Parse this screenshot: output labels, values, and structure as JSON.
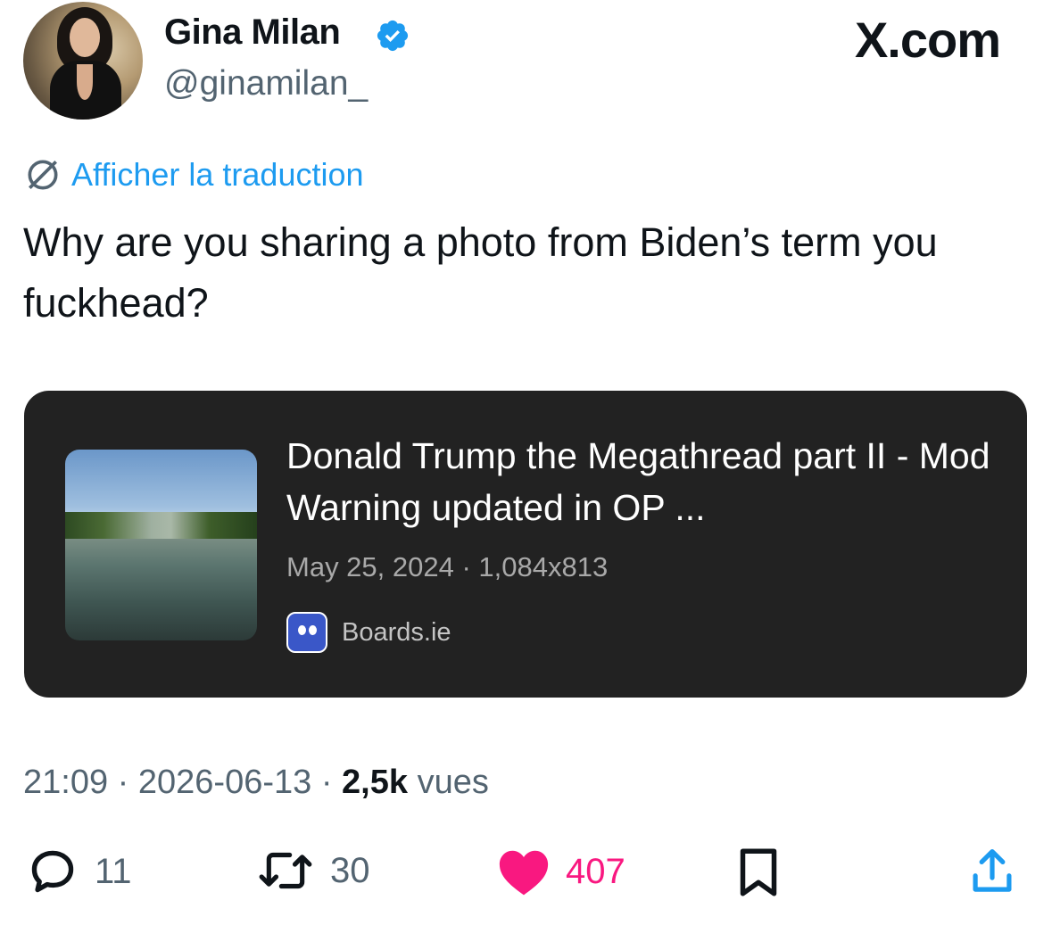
{
  "header": {
    "display_name": "Gina Milan",
    "handle": "@ginamilan_",
    "site_label": "X.com"
  },
  "translate": {
    "label": "Afficher la traduction"
  },
  "tweet": {
    "text": "Why are you sharing a photo from Biden’s term you fuckhead?"
  },
  "card": {
    "title": "Donald Trump the Megathread part II - Mod Warning updated in OP ...",
    "meta": "May 25, 2024 · 1,084x813",
    "source": "Boards.ie"
  },
  "timestamp": {
    "time": "21:09",
    "date": "2026-06-13",
    "views_count": "2,5k",
    "views_label": "vues",
    "separator": "·"
  },
  "actions": {
    "replies": "11",
    "reposts": "30",
    "likes": "407"
  },
  "colors": {
    "accent": "#1d9bf0",
    "like": "#f91880",
    "muted": "#536471",
    "card_bg": "#222222"
  },
  "icons": {
    "verified": "verified-badge-icon",
    "translate": "globe-slash-icon",
    "reply": "reply-icon",
    "repost": "repost-icon",
    "like": "heart-icon",
    "bookmark": "bookmark-icon",
    "share": "share-icon"
  }
}
